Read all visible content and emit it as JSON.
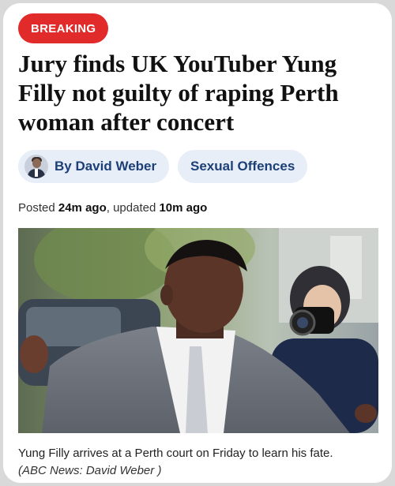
{
  "badge": "BREAKING",
  "headline": "Jury finds UK YouTuber Yung Filly not guilty of raping Perth woman after concert",
  "author": "By David Weber",
  "topic": "Sexual Offences",
  "posted": {
    "prefix": "Posted ",
    "posted_time": "24m ago",
    "mid": ", updated ",
    "updated_time": "10m ago"
  },
  "caption": {
    "text": "Yung Filly arrives at a Perth court on Friday to learn his fate.",
    "credit": "(ABC News: David Weber )"
  },
  "colors": {
    "badge": "#e12a2a",
    "pill_bg": "#e8eef7",
    "pill_text": "#1c3f77"
  }
}
